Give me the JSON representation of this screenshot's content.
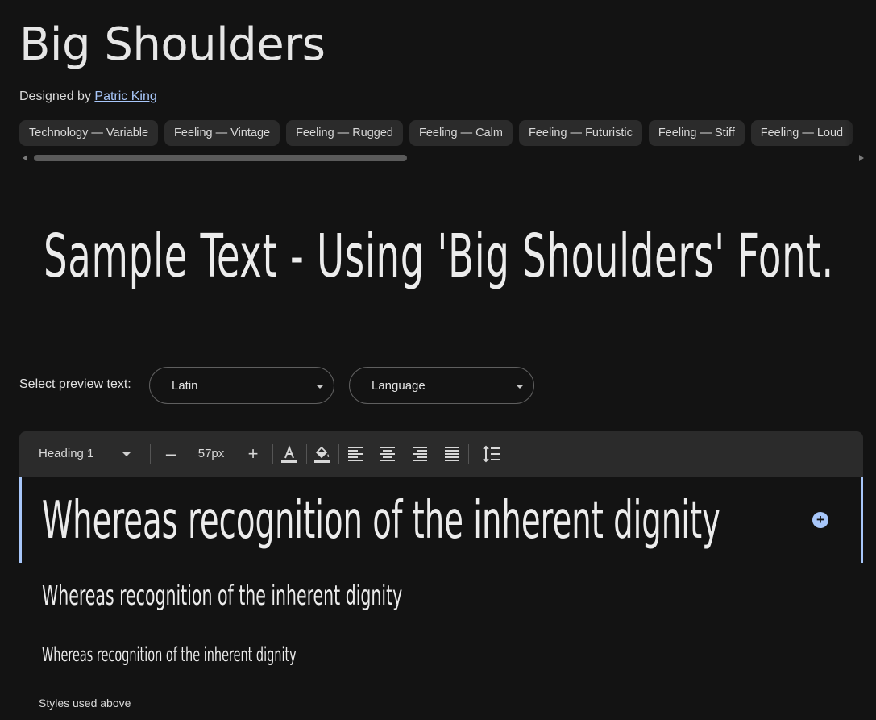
{
  "header": {
    "title": "Big Shoulders",
    "designed_by_prefix": "Designed by ",
    "designer_name": "Patric King"
  },
  "tags": [
    "Technology — Variable",
    "Feeling — Vintage",
    "Feeling — Rugged",
    "Feeling — Calm",
    "Feeling — Futuristic",
    "Feeling — Stiff",
    "Feeling — Loud"
  ],
  "sample_text": "Sample Text - Using 'Big Shoulders' Font.",
  "preview": {
    "label": "Select preview text:",
    "script_value": "Latin",
    "language_placeholder": "Language"
  },
  "toolbar": {
    "style_value": "Heading 1",
    "size_value": "57px",
    "minus_label": "–",
    "plus_label": "+"
  },
  "editor": {
    "line1": "Whereas recognition of the inherent dignity",
    "line2": "Whereas recognition of the inherent dignity",
    "line3": "Whereas recognition of the inherent dignity",
    "add_label": "+"
  },
  "footer": {
    "styles_used": "Styles used above"
  },
  "colors": {
    "background": "#131313",
    "accent": "#a8c7fa",
    "chip": "#2b2b2b"
  }
}
